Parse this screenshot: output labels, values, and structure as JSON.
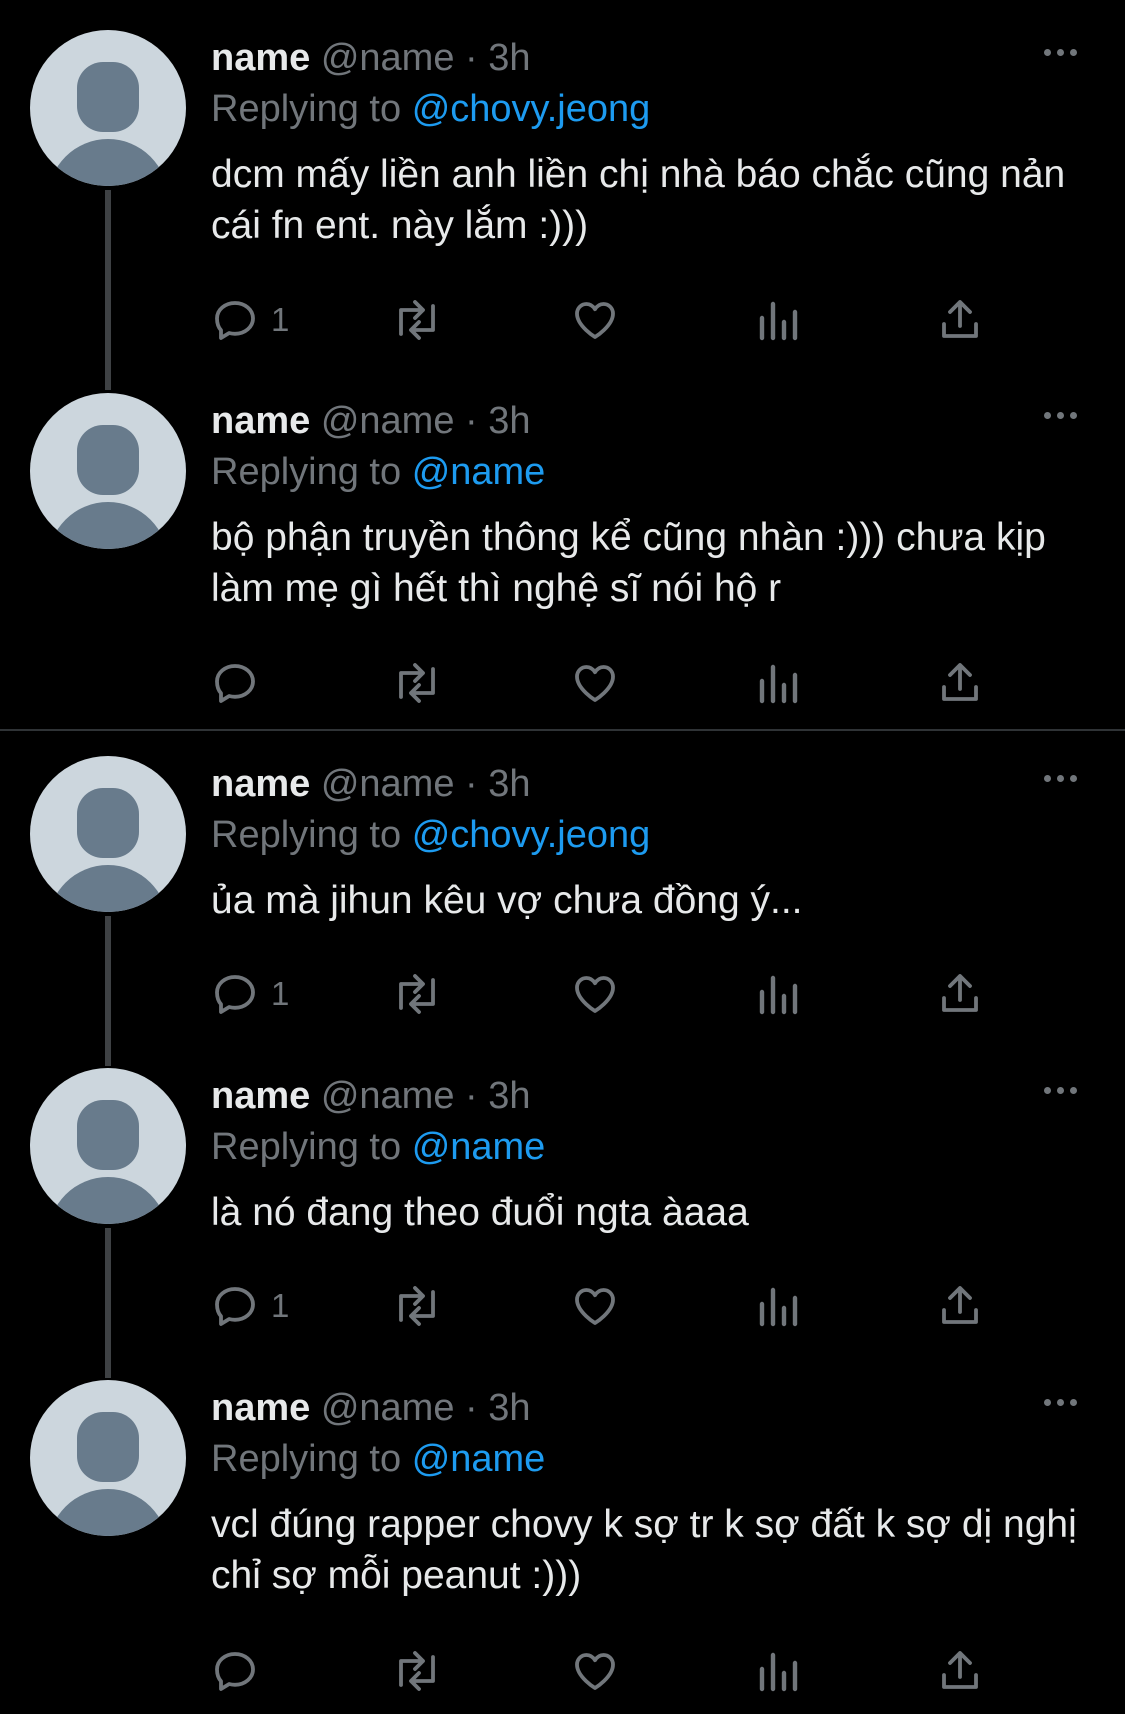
{
  "colors": {
    "background": "#000000",
    "text": "#e7e9ea",
    "muted": "#71767b",
    "link": "#1d9bf0",
    "avatar_bg": "#ccd6dd",
    "avatar_fg": "#687b8c"
  },
  "replying_prefix": "Replying to",
  "tweets": [
    {
      "name": "name",
      "handle": "@name",
      "dot": "·",
      "time": "3h",
      "reply_to": "@chovy.jeong",
      "text": "dcm mấy liền anh liền chị nhà báo chắc cũng nản cái fn ent. này lắm :)))",
      "reply_count": "1",
      "icons": [
        "reply-icon",
        "retweet-icon",
        "like-icon",
        "analytics-icon",
        "share-icon"
      ]
    },
    {
      "name": "name",
      "handle": "@name",
      "dot": "·",
      "time": "3h",
      "reply_to": "@name",
      "text": "bộ phận truyền thông kể cũng nhàn :))) chưa kịp làm mẹ gì hết thì nghệ sĩ nói hộ r",
      "reply_count": "",
      "icons": [
        "reply-icon",
        "retweet-icon",
        "like-icon",
        "analytics-icon",
        "share-icon"
      ]
    },
    {
      "name": "name",
      "handle": "@name",
      "dot": "·",
      "time": "3h",
      "reply_to": "@chovy.jeong",
      "text": "ủa mà jihun kêu vợ chưa đồng ý...",
      "reply_count": "1",
      "icons": [
        "reply-icon",
        "retweet-icon",
        "like-icon",
        "analytics-icon",
        "share-icon"
      ]
    },
    {
      "name": "name",
      "handle": "@name",
      "dot": "·",
      "time": "3h",
      "reply_to": "@name",
      "text": "là nó đang theo đuổi ngta àaaa",
      "reply_count": "1",
      "icons": [
        "reply-icon",
        "retweet-icon",
        "like-icon",
        "analytics-icon",
        "share-icon"
      ]
    },
    {
      "name": "name",
      "handle": "@name",
      "dot": "·",
      "time": "3h",
      "reply_to": "@name",
      "text": "vcl đúng rapper chovy k sợ tr k sợ đất k sợ dị nghị chỉ sợ mỗi peanut :)))",
      "reply_count": "",
      "icons": [
        "reply-icon",
        "retweet-icon",
        "like-icon",
        "analytics-icon",
        "share-icon"
      ]
    }
  ]
}
